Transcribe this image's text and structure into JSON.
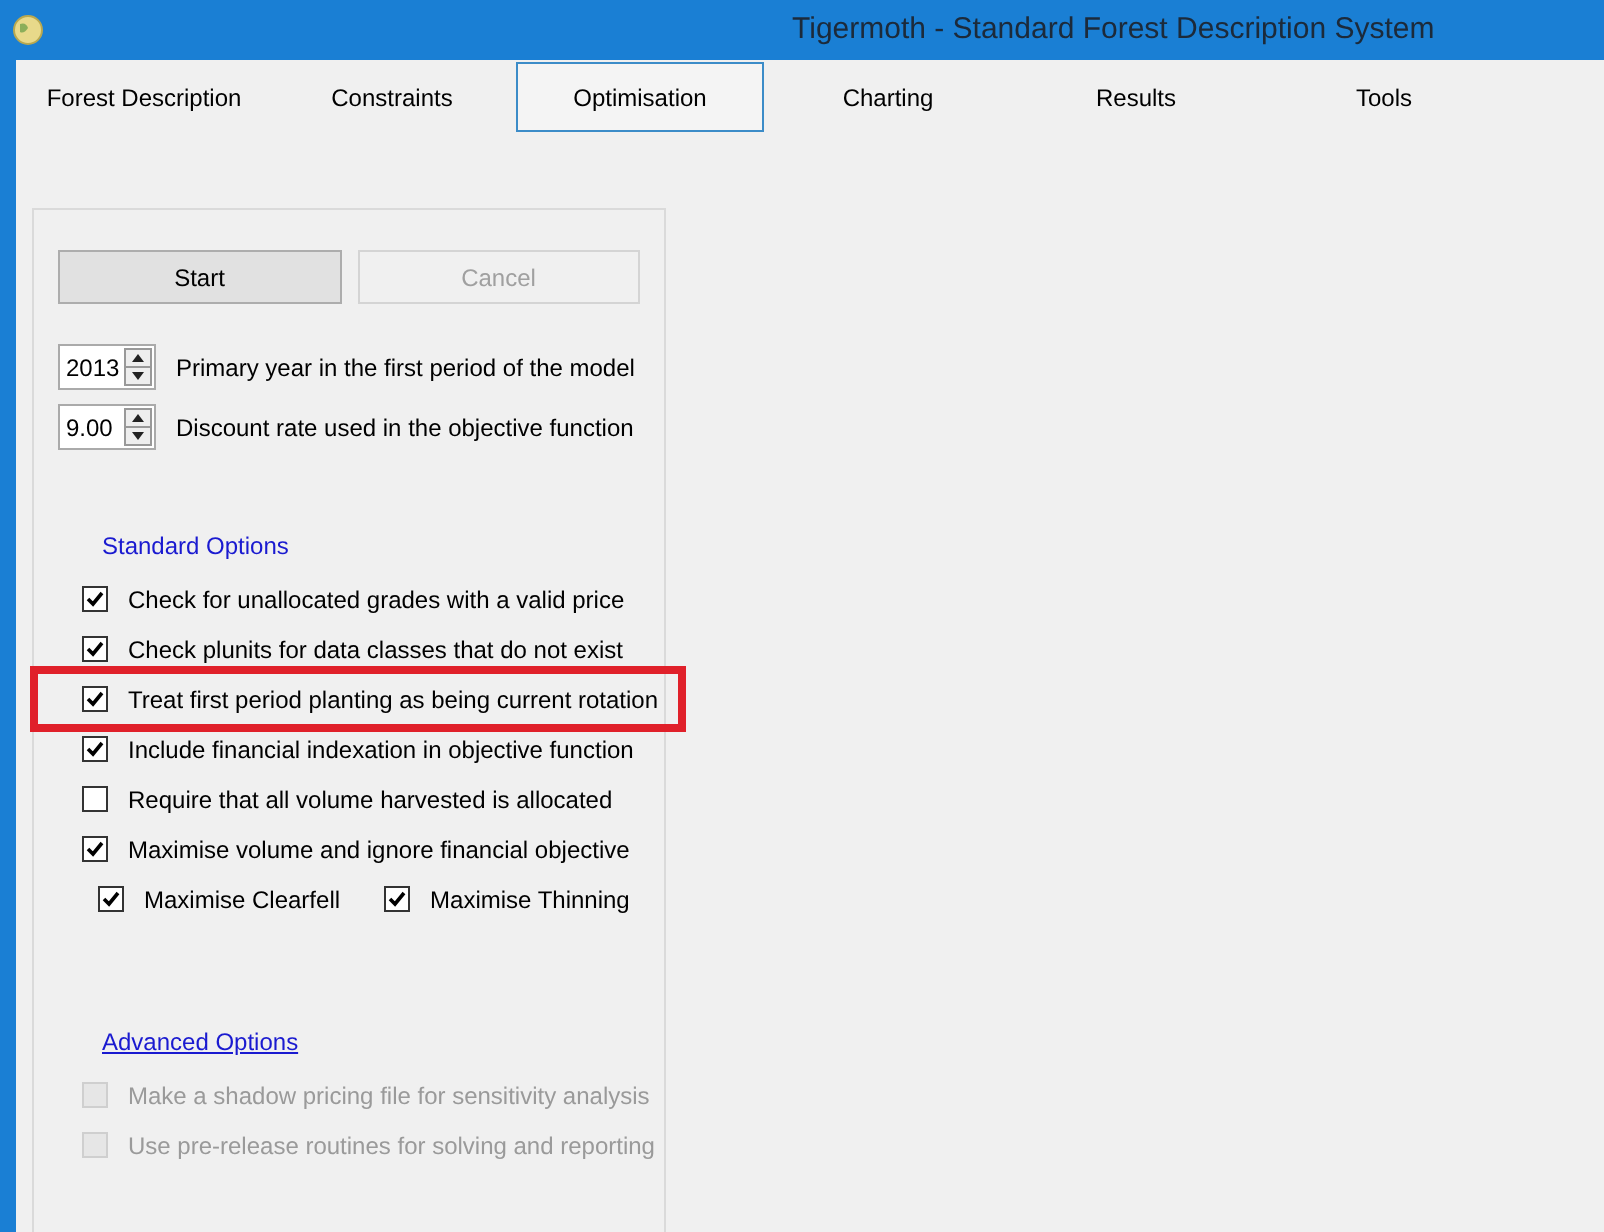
{
  "window": {
    "title": "Tigermoth - Standard Forest Description System"
  },
  "tabs": [
    {
      "label": "Forest Description",
      "selected": false
    },
    {
      "label": "Constraints",
      "selected": false
    },
    {
      "label": "Optimisation",
      "selected": true
    },
    {
      "label": "Charting",
      "selected": false
    },
    {
      "label": "Results",
      "selected": false
    },
    {
      "label": "Tools",
      "selected": false
    }
  ],
  "buttons": [
    {
      "label": "Start",
      "disabled": false
    },
    {
      "label": "Cancel",
      "disabled": true
    }
  ],
  "spinners": [
    {
      "value": "2013",
      "label": "Primary year in the first period of the model"
    },
    {
      "value": "9.00",
      "label": "Discount rate used in the objective function"
    }
  ],
  "standard_options": {
    "heading": "Standard Options",
    "items": [
      {
        "label": "Check for unallocated grades with a valid price",
        "checked": true,
        "disabled": false,
        "highlighted": false
      },
      {
        "label": "Check plunits for data classes that do not exist",
        "checked": true,
        "disabled": false,
        "highlighted": false
      },
      {
        "label": "Treat first period planting as being current rotation",
        "checked": true,
        "disabled": false,
        "highlighted": true
      },
      {
        "label": "Include financial indexation in objective function",
        "checked": true,
        "disabled": false,
        "highlighted": false
      },
      {
        "label": "Require that all volume harvested is allocated",
        "checked": false,
        "disabled": false,
        "highlighted": false
      },
      {
        "label": "Maximise volume and ignore financial objective",
        "checked": true,
        "disabled": false,
        "highlighted": false
      }
    ],
    "sub_items": [
      {
        "label": "Maximise Clearfell",
        "checked": true,
        "disabled": false
      },
      {
        "label": "Maximise Thinning",
        "checked": true,
        "disabled": false
      }
    ]
  },
  "advanced_options": {
    "heading": "Advanced Options",
    "items": [
      {
        "label": "Make a shadow pricing file for sensitivity analysis",
        "checked": false,
        "disabled": true,
        "highlighted": false
      },
      {
        "label": "Use pre-release routines for solving and reporting",
        "checked": false,
        "disabled": true,
        "highlighted": false
      }
    ]
  }
}
